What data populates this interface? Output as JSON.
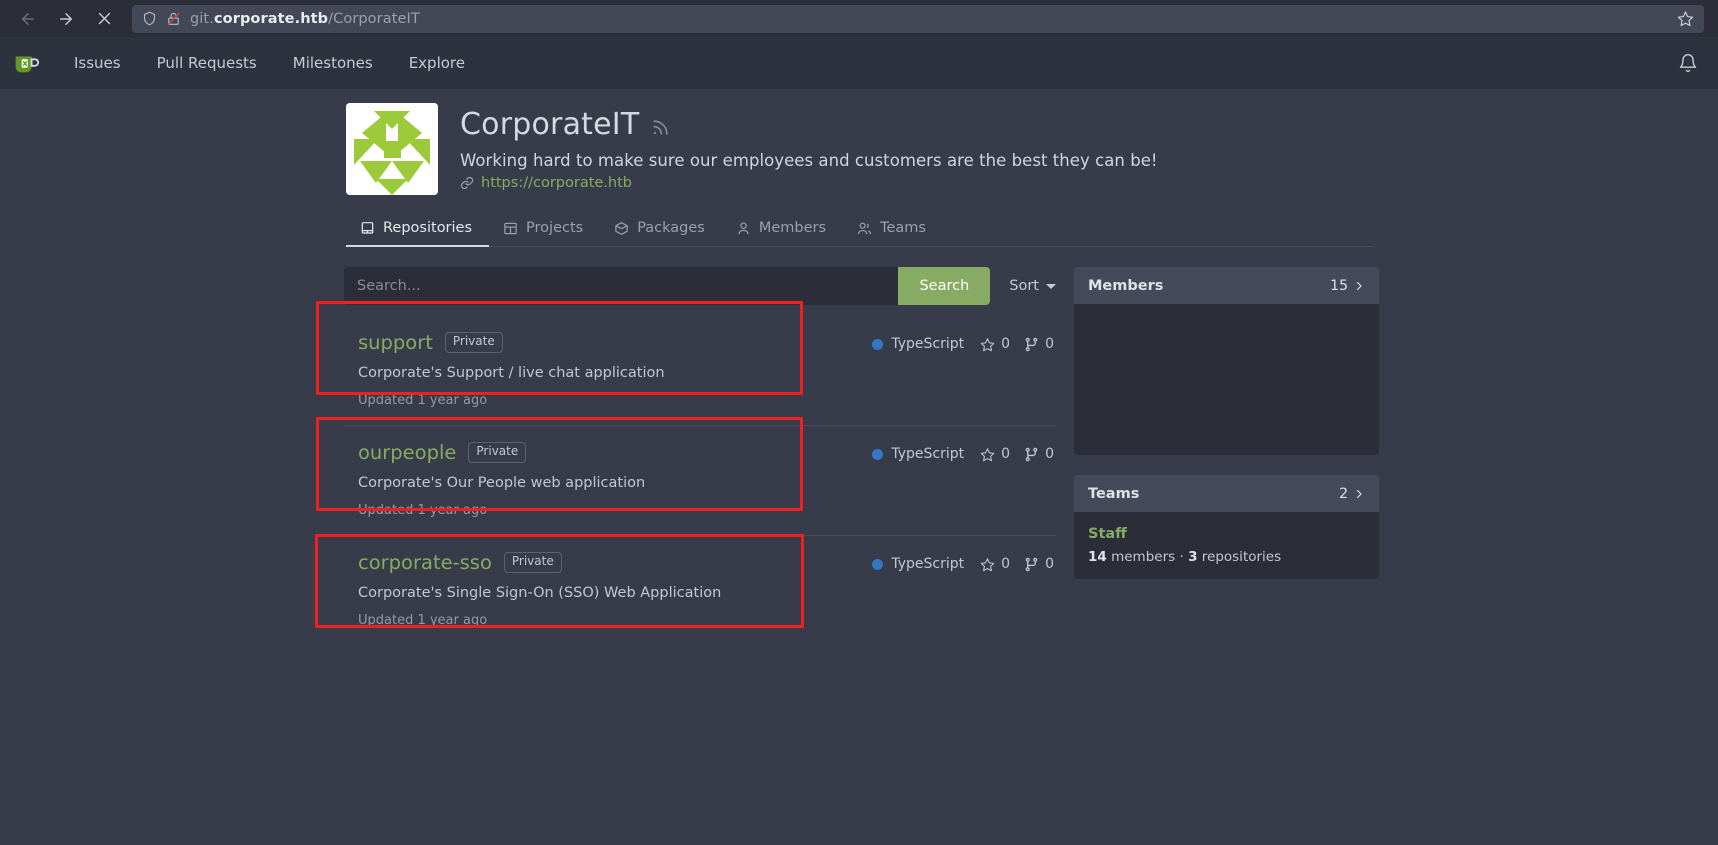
{
  "browser": {
    "back_icon": "arrow-left-icon",
    "forward_icon": "arrow-right-icon",
    "stop_icon": "stop-loading-icon",
    "shield_icon": "shield-icon",
    "lock_broken_icon": "insecure-lock-icon",
    "url_prefix": "git.",
    "url_host": "corporate.htb",
    "url_path": "/CorporateIT",
    "bookmark_icon": "star-outline-icon"
  },
  "navbar": {
    "logo_icon": "gitea-mug-logo",
    "links": [
      {
        "label": "Issues",
        "name": "nav-issues"
      },
      {
        "label": "Pull Requests",
        "name": "nav-pull-requests"
      },
      {
        "label": "Milestones",
        "name": "nav-milestones"
      },
      {
        "label": "Explore",
        "name": "nav-explore"
      }
    ],
    "notifications_icon": "bell-icon"
  },
  "org": {
    "avatar_alt": "organization-identicon-avatar",
    "name": "CorporateIT",
    "rss_icon": "rss-feed-icon",
    "description": "Working hard to make sure our employees and customers are the best they can be!",
    "website_icon": "link-icon",
    "website": "https://corporate.htb"
  },
  "tabs": [
    {
      "label": "Repositories",
      "icon": "repo-icon",
      "active": true
    },
    {
      "label": "Projects",
      "icon": "project-board-icon",
      "active": false
    },
    {
      "label": "Packages",
      "icon": "package-icon",
      "active": false
    },
    {
      "label": "Members",
      "icon": "person-icon",
      "active": false
    },
    {
      "label": "Teams",
      "icon": "people-icon",
      "active": false
    }
  ],
  "search": {
    "value": "",
    "placeholder": "Search...",
    "button_label": "Search",
    "sort_label": "Sort"
  },
  "repositories": [
    {
      "name": "support",
      "visibility": "Private",
      "description": "Corporate's Support / live chat application",
      "updated": "Updated 1 year ago",
      "language": "TypeScript",
      "language_color": "#3178c6",
      "stars": "0",
      "forks": "0",
      "highlighted": true
    },
    {
      "name": "ourpeople",
      "visibility": "Private",
      "description": "Corporate's Our People web application",
      "updated": "Updated 1 year ago",
      "language": "TypeScript",
      "language_color": "#3178c6",
      "stars": "0",
      "forks": "0",
      "highlighted": true
    },
    {
      "name": "corporate-sso",
      "visibility": "Private",
      "description": "Corporate's Single Sign-On (SSO) Web Application",
      "updated": "Updated 1 year ago",
      "language": "TypeScript",
      "language_color": "#3178c6",
      "stars": "0",
      "forks": "0",
      "highlighted": true
    }
  ],
  "sidebar": {
    "members": {
      "title": "Members",
      "count": "15",
      "chevron_icon": "chevron-right-icon"
    },
    "teams": {
      "title": "Teams",
      "count": "2",
      "chevron_icon": "chevron-right-icon",
      "items": [
        {
          "name": "Staff",
          "members_count": "14",
          "members_word": "members",
          "repos_count": "3",
          "repos_word": "repositories",
          "separator": "·"
        }
      ]
    }
  },
  "theme": {
    "page_bg": "#383c4a",
    "nav_bg": "#2e323e",
    "accent_green": "#87ab63",
    "annotation_red": "#ef2020",
    "card_head_bg": "#454a5a",
    "card_body_bg": "#2b2e39"
  }
}
